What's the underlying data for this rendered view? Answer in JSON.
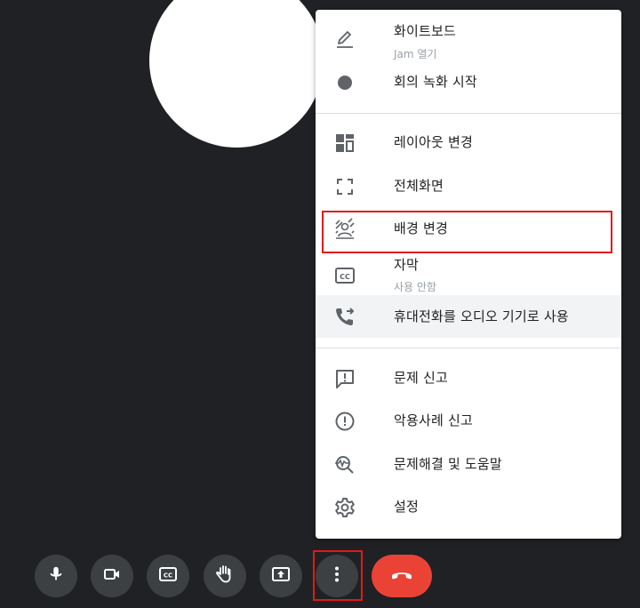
{
  "menu": {
    "items": [
      {
        "label": "화이트보드",
        "sub": "Jam 열기",
        "icon": "pen-icon"
      },
      {
        "label": "회의 녹화 시작",
        "icon": "record-dot-icon"
      },
      {
        "label": "레이아웃 변경",
        "icon": "layout-icon"
      },
      {
        "label": "전체화면",
        "icon": "fullscreen-icon"
      },
      {
        "label": "배경 변경",
        "icon": "background-icon"
      },
      {
        "label": "자막",
        "sub": "사용 안함",
        "icon": "captions-icon"
      },
      {
        "label": "휴대전화를 오디오 기기로 사용",
        "icon": "phone-forward-icon"
      },
      {
        "label": "문제 신고",
        "icon": "feedback-icon"
      },
      {
        "label": "악용사례 신고",
        "icon": "report-icon"
      },
      {
        "label": "문제해결 및 도움말",
        "icon": "troubleshoot-icon"
      },
      {
        "label": "설정",
        "icon": "settings-icon"
      }
    ]
  },
  "controls": [
    {
      "name": "mic",
      "icon": "mic-icon"
    },
    {
      "name": "camera",
      "icon": "camera-icon"
    },
    {
      "name": "captions",
      "icon": "captions-icon"
    },
    {
      "name": "raise-hand",
      "icon": "hand-icon"
    },
    {
      "name": "present",
      "icon": "present-icon"
    },
    {
      "name": "more-options",
      "icon": "more-vert-icon"
    },
    {
      "name": "leave-call",
      "icon": "hangup-icon"
    }
  ],
  "colors": {
    "background": "#202124",
    "control": "#3c4043",
    "hangup": "#ea4335",
    "highlight": "#e01b1b",
    "menu_text": "#202124",
    "menu_icon": "#5f6368"
  }
}
